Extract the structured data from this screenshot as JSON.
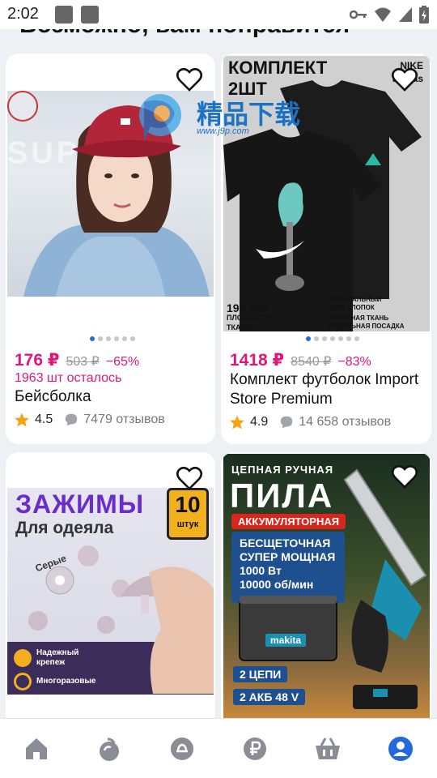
{
  "status": {
    "time": "2:02"
  },
  "heading": "Возможно, вам понравится",
  "products": [
    {
      "price": "176 ₽",
      "old_price": "503 ₽",
      "discount": "−65%",
      "stock": "1963 шт осталось",
      "title": "Бейсболка",
      "rating": "4.5",
      "reviews": "7479 отзывов",
      "image": {
        "brand_text": "SUP  P",
        "dots": 6,
        "active_dot": 0
      }
    },
    {
      "price": "1418 ₽",
      "old_price": "8540 ₽",
      "discount": "−83%",
      "title": "Комплект футболок Import Store Premium",
      "rating": "4.9",
      "reviews": "14 658 отзывов",
      "image": {
        "line1": "КОМПЛЕКТ",
        "line2": "2ШТ",
        "density": "190 г/м²",
        "density_label_1": "ПЛОТНОСТЬ",
        "density_label_2": "ТКАНИ",
        "feature1_a": "ПРЕМИАЛЬНЫЙ",
        "feature1_b": "100% ХЛОПОК",
        "feature2_a": "ПРИЯТНАЯ ТКАНЬ",
        "feature2_b": "ИДЕАЛЬНАЯ ПОСАДКА",
        "brand1": "NIKE",
        "brand2": "adidas",
        "dots": 7,
        "active_dot": 0
      }
    },
    {
      "image": {
        "title": "ЗАЖИМЫ",
        "subtitle": "Для одеяла",
        "badge_num": "10",
        "badge_unit": "штук",
        "tag": "Серые",
        "feature1_a": "Надежный",
        "feature1_b": "крепеж",
        "feature2": "Многоразовые"
      }
    },
    {
      "image": {
        "top": "ЦЕПНАЯ  РУЧНАЯ",
        "title": "ПИЛА",
        "banner": "АККУМУЛЯТОРНАЯ",
        "spec1": "БЕСЩЕТОЧНАЯ",
        "spec2": "СУПЕР МОЩНАЯ",
        "spec3": "1000 Вт",
        "spec4": "10000 об/мин",
        "brand": "makita",
        "chains": "2 ЦЕПИ",
        "battery": "2 АКБ 48 V"
      }
    }
  ],
  "watermark": {
    "text": "精品下载",
    "url": "www.j9p.com"
  },
  "colors": {
    "accent": "#e0177a",
    "nav_active": "#2468e0",
    "nav_inactive": "#8a8d96"
  }
}
